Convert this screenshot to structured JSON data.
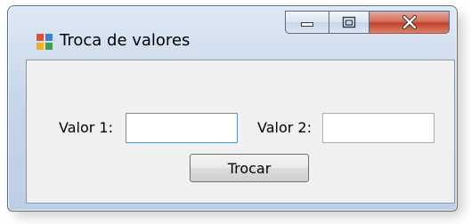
{
  "window": {
    "title": "Troca de valores",
    "icon": "windows-form-icon",
    "controls": {
      "minimize": "minimize-icon",
      "maximize": "maximize-icon",
      "close": "close-icon"
    }
  },
  "form": {
    "valor1_label": "Valor 1:",
    "valor1_value": "",
    "valor2_label": "Valor 2:",
    "valor2_value": "",
    "button_label": "Trocar"
  }
}
